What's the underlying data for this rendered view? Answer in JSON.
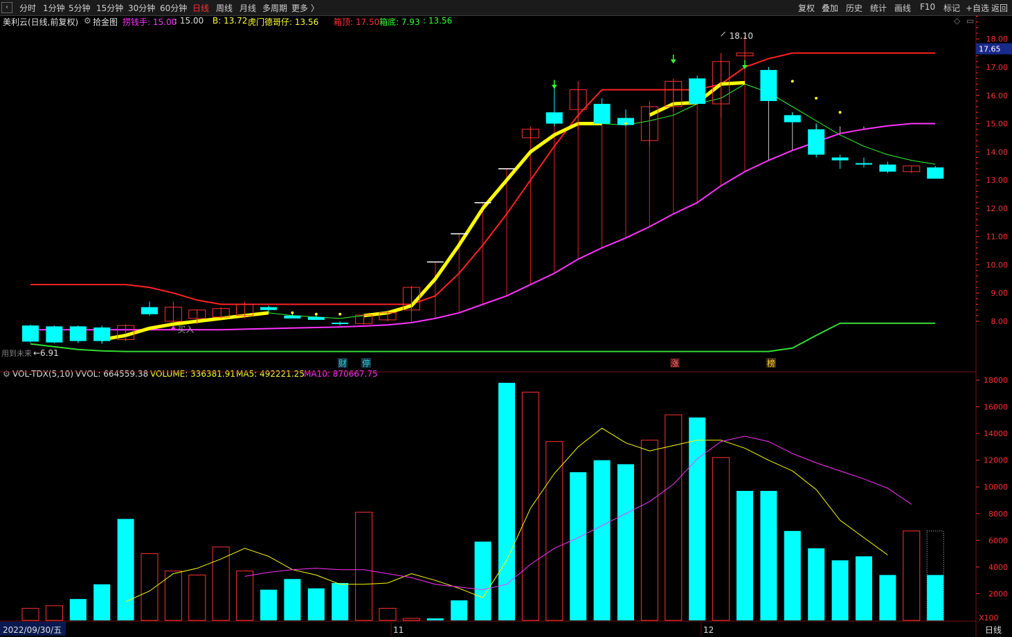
{
  "toolbar": {
    "left": [
      "分时",
      "1分钟",
      "5分钟",
      "15分钟",
      "30分钟",
      "60分钟",
      "日线",
      "周线",
      "月线",
      "多周期",
      "更多 〉"
    ],
    "active": "日线",
    "right": [
      "复权",
      "叠加",
      "历史",
      "统计",
      "画线",
      "F10",
      "标记",
      "+自选",
      "返回"
    ]
  },
  "main_panel": {
    "stock_title": "美利云(日线,前复权)",
    "indicator_name": "拾金图",
    "legend": [
      {
        "text": "捞钱手: 15.00",
        "color": "#ff33ff"
      },
      {
        "text": ": 15.00",
        "color": "#e0e0e0"
      },
      {
        "text": "B: 13.72",
        "color": "#ffff33"
      },
      {
        "text": "虎门德哥仔: 13.56",
        "color": "#ffff33"
      },
      {
        "text": "箱顶: 17.50",
        "color": "#ff3333"
      },
      {
        "text": "箱底: 7.93",
        "color": "#33ff33"
      },
      {
        "text": ": 13.56",
        "color": "#33ff33"
      }
    ],
    "current_price": "17.65",
    "high_label": "18.10",
    "low_label": "←6.91",
    "buy_label": "买入",
    "footnote": "用到未来",
    "event_tags": [
      {
        "text": "财",
        "color": "#33cccc",
        "bg": "#123a48"
      },
      {
        "text": "停",
        "color": "#33cccc",
        "bg": "#123a48"
      },
      {
        "text": "涨",
        "color": "#ff7777",
        "bg": "#4a1010"
      },
      {
        "text": "榜",
        "color": "#ffcc33",
        "bg": "#40300a"
      }
    ],
    "y_ticks": [
      "8.00",
      "9.00",
      "10.00",
      "11.00",
      "12.00",
      "13.00",
      "14.00",
      "15.00",
      "16.00",
      "17.00",
      "18.00"
    ]
  },
  "volume_panel": {
    "legend": [
      {
        "text": "VOL-TDX(5,10)",
        "color": "#e0e0e0"
      },
      {
        "text": "VVOL: 664559.38",
        "color": "#e0e0e0"
      },
      {
        "text": "VOLUME: 336381.91",
        "color": "#ffff33"
      },
      {
        "text": "MA5: 492221.25",
        "color": "#ffff33"
      },
      {
        "text": "MA10: 870667.75",
        "color": "#ff33ff"
      }
    ],
    "y_ticks": [
      "2000",
      "4000",
      "6000",
      "8000",
      "10000",
      "12000",
      "14000",
      "16000",
      "18000"
    ],
    "unit": "X100"
  },
  "bottom": {
    "start_date": "2022/09/30/五",
    "month_marks": [
      "11",
      "12"
    ],
    "period": "日线"
  },
  "colors": {
    "up": "#ff3333",
    "down": "#00ffff",
    "price_axis": "#ff3333",
    "yellow": "#ffff00",
    "magenta": "#ff33ff",
    "green": "#33ff33"
  },
  "chart_data": [
    {
      "type": "candlestick",
      "title": "美利云(日线,前复权)",
      "ylim": [
        6.9,
        18.4
      ],
      "ohlc": [
        {
          "o": 7.85,
          "h": 7.88,
          "l": 7.25,
          "c": 7.28
        },
        {
          "o": 7.82,
          "h": 7.84,
          "l": 7.22,
          "c": 7.25
        },
        {
          "o": 7.82,
          "h": 7.84,
          "l": 7.23,
          "c": 7.3
        },
        {
          "o": 7.78,
          "h": 7.8,
          "l": 7.2,
          "c": 7.3
        },
        {
          "o": 7.35,
          "h": 7.9,
          "l": 7.3,
          "c": 7.85
        },
        {
          "o": 8.5,
          "h": 8.7,
          "l": 8.2,
          "c": 8.25
        },
        {
          "o": 8.0,
          "h": 8.7,
          "l": 7.98,
          "c": 8.5
        },
        {
          "o": 8.1,
          "h": 8.4,
          "l": 7.9,
          "c": 8.4
        },
        {
          "o": 8.15,
          "h": 8.5,
          "l": 8.1,
          "c": 8.45
        },
        {
          "o": 8.2,
          "h": 8.7,
          "l": 8.1,
          "c": 8.6
        },
        {
          "o": 8.5,
          "h": 8.55,
          "l": 8.3,
          "c": 8.4
        },
        {
          "o": 8.2,
          "h": 8.3,
          "l": 8.1,
          "c": 8.1
        },
        {
          "o": 8.15,
          "h": 8.2,
          "l": 8.05,
          "c": 8.05
        },
        {
          "o": 7.95,
          "h": 8.0,
          "l": 7.85,
          "c": 7.9
        },
        {
          "o": 7.92,
          "h": 8.25,
          "l": 7.88,
          "c": 8.22
        },
        {
          "o": 8.05,
          "h": 8.4,
          "l": 8.0,
          "c": 8.3
        },
        {
          "o": 8.4,
          "h": 9.25,
          "l": 8.35,
          "c": 9.2
        },
        {
          "o": 10.1,
          "h": 10.1,
          "l": 10.1,
          "c": 10.1
        },
        {
          "o": 11.1,
          "h": 11.1,
          "l": 11.1,
          "c": 11.1
        },
        {
          "o": 12.2,
          "h": 12.2,
          "l": 12.2,
          "c": 12.2
        },
        {
          "o": 13.4,
          "h": 13.4,
          "l": 13.4,
          "c": 13.4
        },
        {
          "o": 14.5,
          "h": 14.9,
          "l": 14.5,
          "c": 14.8
        },
        {
          "o": 15.4,
          "h": 16.3,
          "l": 14.9,
          "c": 15.0
        },
        {
          "o": 15.5,
          "h": 16.5,
          "l": 14.8,
          "c": 16.2
        },
        {
          "o": 15.7,
          "h": 15.9,
          "l": 15.0,
          "c": 15.0
        },
        {
          "o": 15.2,
          "h": 15.5,
          "l": 14.9,
          "c": 14.95
        },
        {
          "o": 14.4,
          "h": 15.8,
          "l": 14.2,
          "c": 15.6
        },
        {
          "o": 15.6,
          "h": 16.6,
          "l": 15.4,
          "c": 16.5
        },
        {
          "o": 16.6,
          "h": 16.7,
          "l": 15.7,
          "c": 15.7
        },
        {
          "o": 15.7,
          "h": 17.5,
          "l": 15.2,
          "c": 17.2
        },
        {
          "o": 17.4,
          "h": 18.1,
          "l": 16.8,
          "c": 17.5
        },
        {
          "o": 16.9,
          "h": 17.0,
          "l": 15.8,
          "c": 15.8
        },
        {
          "o": 15.3,
          "h": 15.4,
          "l": 15.0,
          "c": 15.05
        },
        {
          "o": 14.8,
          "h": 15.0,
          "l": 13.8,
          "c": 13.9
        },
        {
          "o": 13.8,
          "h": 13.9,
          "l": 13.4,
          "c": 13.7
        },
        {
          "o": 13.6,
          "h": 13.8,
          "l": 13.45,
          "c": 13.55
        },
        {
          "o": 13.55,
          "h": 13.65,
          "l": 13.25,
          "c": 13.3
        },
        {
          "o": 13.3,
          "h": 13.5,
          "l": 13.25,
          "c": 13.5
        },
        {
          "o": 13.45,
          "h": 13.5,
          "l": 13.05,
          "c": 13.05
        }
      ],
      "series": [
        {
          "name": "捞钱手",
          "color": "#ff33ff",
          "values": [
            7.7,
            7.7,
            7.7,
            7.7,
            7.7,
            7.7,
            7.7,
            7.7,
            7.7,
            7.72,
            7.74,
            7.76,
            7.78,
            7.8,
            7.83,
            7.87,
            7.95,
            8.1,
            8.3,
            8.6,
            8.9,
            9.3,
            9.7,
            10.2,
            10.6,
            10.95,
            11.35,
            11.8,
            12.2,
            12.8,
            13.3,
            13.7,
            14.05,
            14.35,
            14.65,
            14.8,
            14.92,
            15.0,
            15.0
          ]
        },
        {
          "name": "B",
          "color": "#ffff00",
          "values": [
            null,
            null,
            null,
            7.35,
            7.5,
            7.75,
            7.9,
            8.0,
            8.1,
            8.2,
            8.3,
            null,
            null,
            null,
            8.2,
            8.3,
            8.55,
            9.5,
            10.7,
            12.0,
            13.0,
            14.0,
            14.6,
            15.0,
            15.0,
            null,
            15.3,
            15.7,
            15.75,
            16.4,
            16.45,
            null,
            null,
            null,
            null,
            null,
            null,
            null,
            null
          ]
        },
        {
          "name": "虎门德哥仔",
          "color": "#33ff33",
          "values": [
            null,
            null,
            null,
            null,
            null,
            null,
            null,
            null,
            null,
            null,
            8.3,
            8.2,
            8.15,
            8.1,
            8.2,
            8.3,
            8.55,
            null,
            null,
            null,
            null,
            null,
            null,
            15.0,
            15.0,
            14.95,
            15.1,
            15.3,
            15.7,
            15.9,
            16.4,
            16.1,
            15.6,
            15.1,
            14.6,
            14.2,
            13.9,
            13.7,
            13.56
          ]
        },
        {
          "name": "箱顶",
          "color": "#ff2222",
          "values": [
            9.3,
            9.3,
            9.3,
            9.3,
            9.3,
            9.2,
            9.0,
            8.75,
            8.6,
            8.6,
            8.6,
            8.6,
            8.6,
            8.6,
            8.6,
            8.6,
            8.6,
            8.9,
            9.7,
            10.7,
            11.8,
            13.0,
            14.2,
            15.3,
            16.2,
            16.2,
            16.2,
            16.2,
            16.2,
            16.4,
            17.0,
            17.3,
            17.5,
            17.5,
            17.5,
            17.5,
            17.5,
            17.5,
            17.5
          ]
        },
        {
          "name": "箱底",
          "color": "#33dd33",
          "values": [
            7.2,
            7.1,
            7.0,
            6.95,
            6.93,
            6.93,
            6.93,
            6.93,
            6.93,
            6.93,
            6.93,
            6.93,
            6.93,
            6.93,
            6.93,
            6.93,
            6.93,
            6.93,
            6.93,
            6.93,
            6.93,
            6.93,
            6.93,
            6.93,
            6.93,
            6.93,
            6.93,
            6.93,
            6.93,
            6.93,
            6.93,
            6.93,
            7.05,
            7.5,
            7.93,
            7.93,
            7.93,
            7.93,
            7.93
          ]
        }
      ]
    },
    {
      "type": "bar",
      "title": "VOL-TDX(5,10)",
      "ylabel": "X100",
      "ylim": [
        0,
        18500
      ],
      "volume_up": [
        true,
        true,
        false,
        false,
        false,
        true,
        true,
        true,
        true,
        true,
        false,
        false,
        false,
        false,
        true,
        true,
        true,
        false,
        false,
        false,
        false,
        true,
        true,
        false,
        false,
        false,
        true,
        true,
        false,
        true,
        false,
        false,
        false,
        false,
        false,
        false,
        false,
        true,
        false
      ],
      "values": [
        900,
        1100,
        1600,
        2700,
        7600,
        5000,
        3700,
        3400,
        5500,
        3700,
        2300,
        3100,
        2400,
        2800,
        8100,
        900,
        150,
        150,
        1500,
        5900,
        17800,
        17100,
        13400,
        11100,
        12000,
        11700,
        13500,
        15400,
        15200,
        12200,
        9700,
        9700,
        6700,
        5400,
        4500,
        4800,
        3400,
        6700,
        3400
      ],
      "series": [
        {
          "name": "MA5",
          "color": "#ffff33",
          "values": [
            null,
            null,
            null,
            null,
            1400,
            2200,
            3500,
            3900,
            4600,
            5400,
            4800,
            3800,
            3400,
            2700,
            2700,
            2800,
            3500,
            3000,
            2400,
            1700,
            4500,
            8400,
            11000,
            13000,
            14400,
            13300,
            12700,
            13100,
            13500,
            13500,
            12900,
            12000,
            11200,
            9800,
            7500,
            6200,
            4900
          ]
        },
        {
          "name": "MA10",
          "color": "#ff33ff",
          "values": [
            null,
            null,
            null,
            null,
            null,
            null,
            null,
            null,
            null,
            3300,
            3600,
            3800,
            3900,
            3800,
            3800,
            3500,
            3200,
            2700,
            2500,
            2300,
            2700,
            4200,
            5400,
            6200,
            7100,
            8000,
            8900,
            10200,
            12100,
            13400,
            13800,
            13400,
            12500,
            11800,
            11200,
            10600,
            9900,
            8700
          ]
        }
      ]
    }
  ]
}
